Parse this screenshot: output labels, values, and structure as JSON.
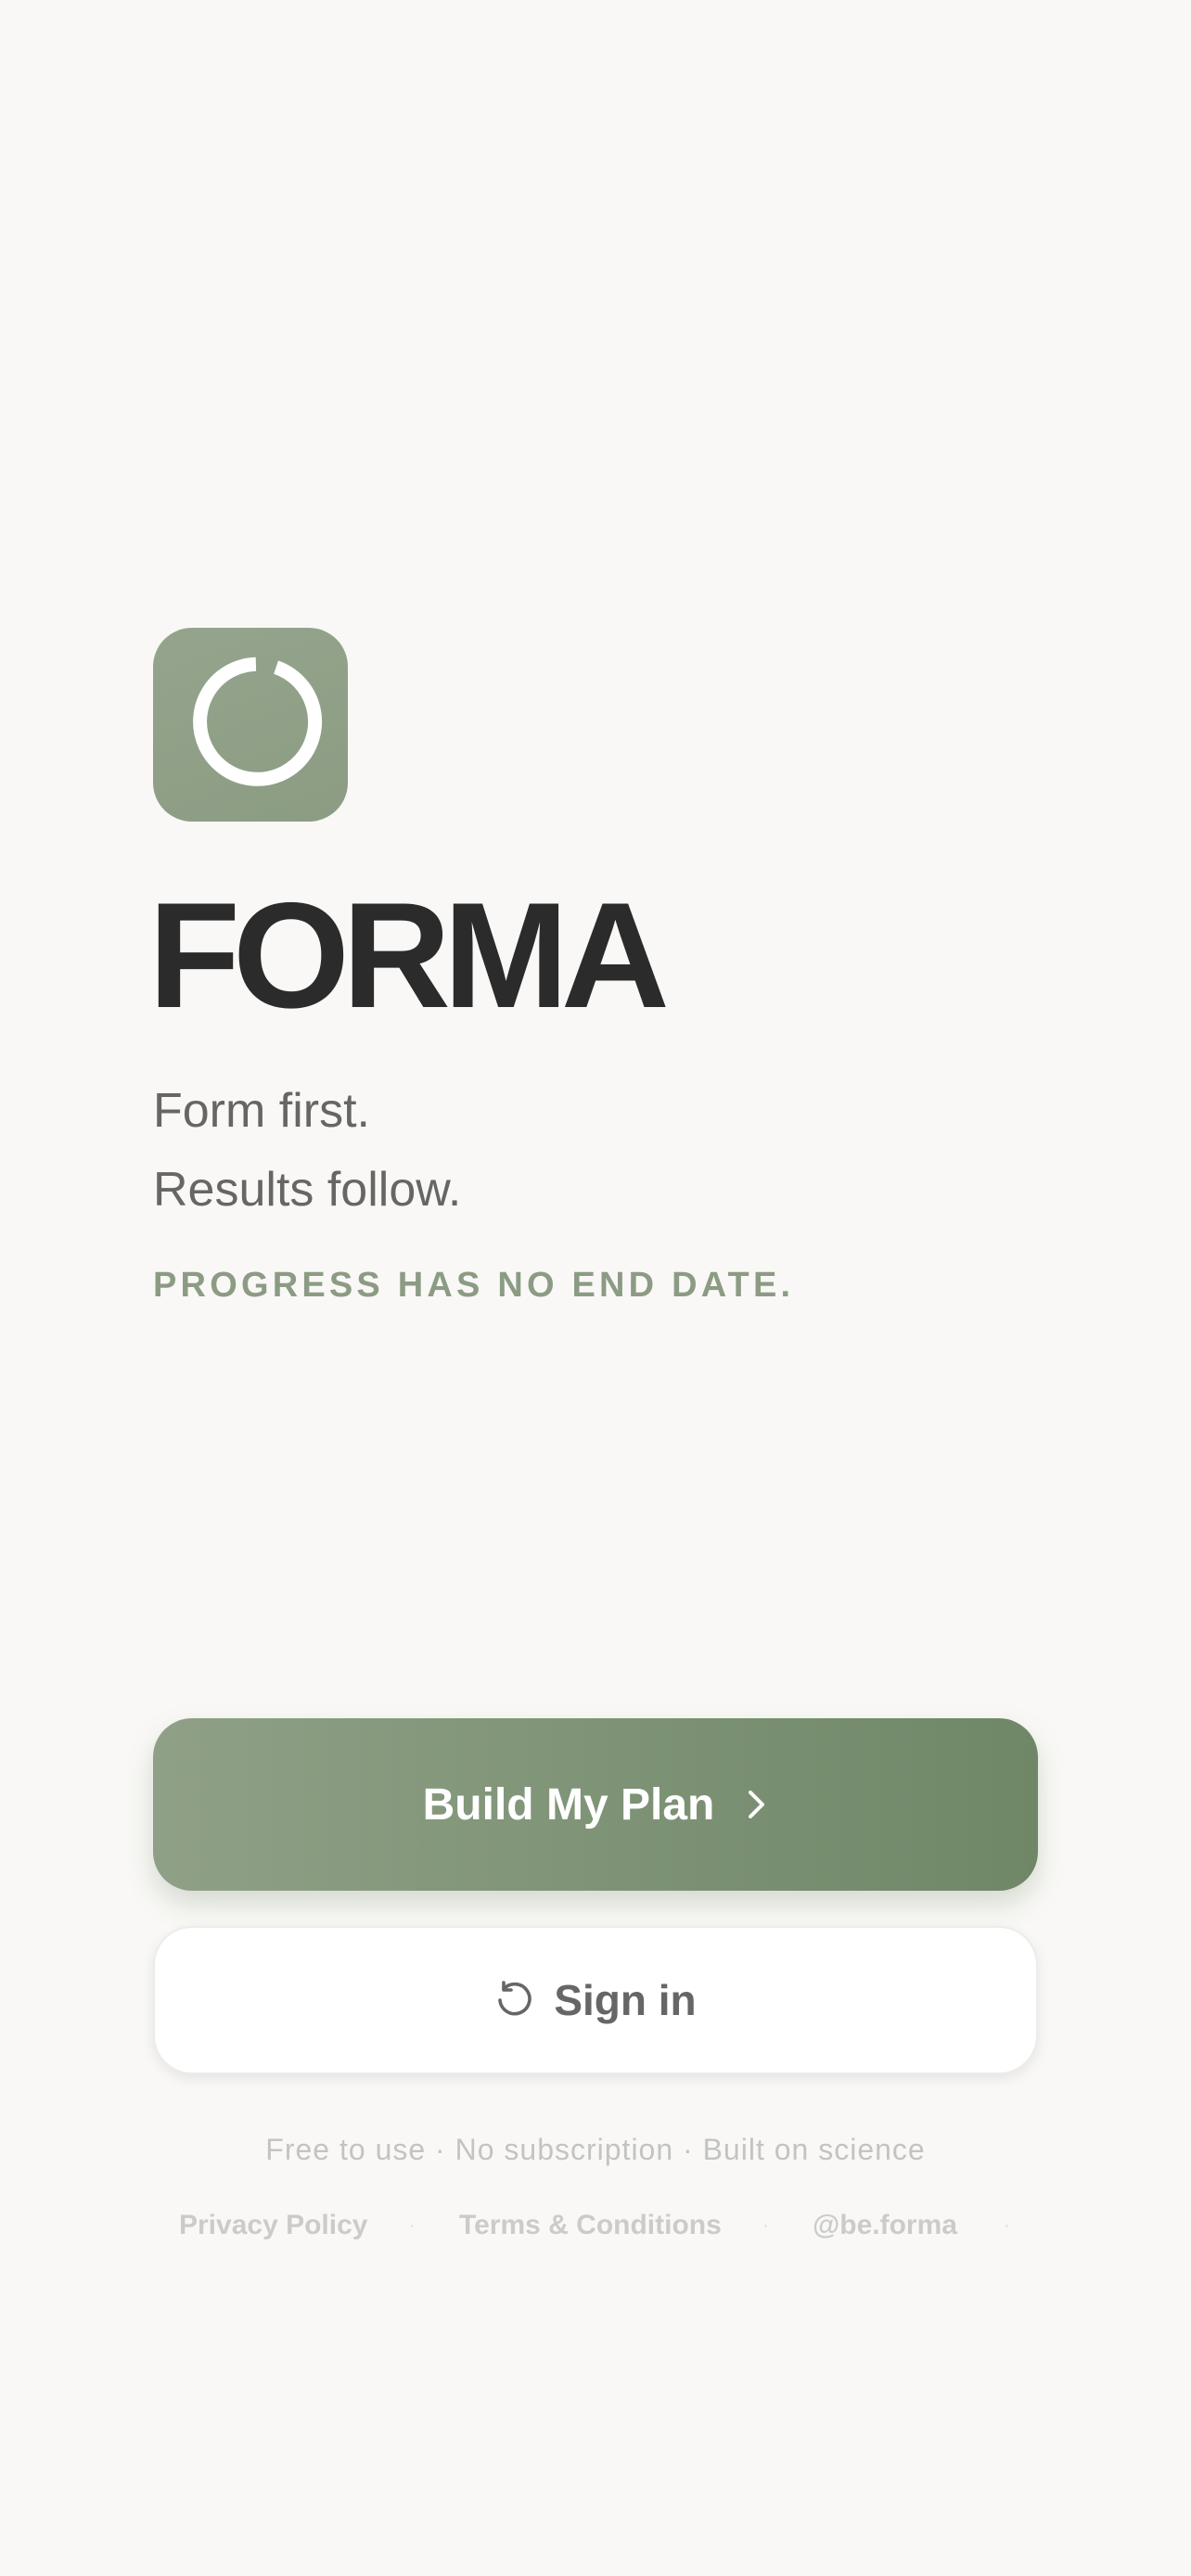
{
  "brand": {
    "title": "FORMA",
    "tagline_line1": "Form first.",
    "tagline_line2": "Results follow.",
    "motto": "PROGRESS HAS NO END DATE.",
    "accent_color": "#8c9c84",
    "icon": "ring-logo-icon"
  },
  "actions": {
    "primary_label": "Build My Plan",
    "primary_icon": "chevron-right-icon",
    "secondary_label": "Sign in",
    "secondary_icon": "refresh-icon"
  },
  "footer": {
    "note": "Free to use · No subscription · Built on science",
    "links": {
      "privacy": "Privacy Policy",
      "terms": "Terms & Conditions",
      "handle": "@be.forma"
    },
    "separator": "·"
  }
}
